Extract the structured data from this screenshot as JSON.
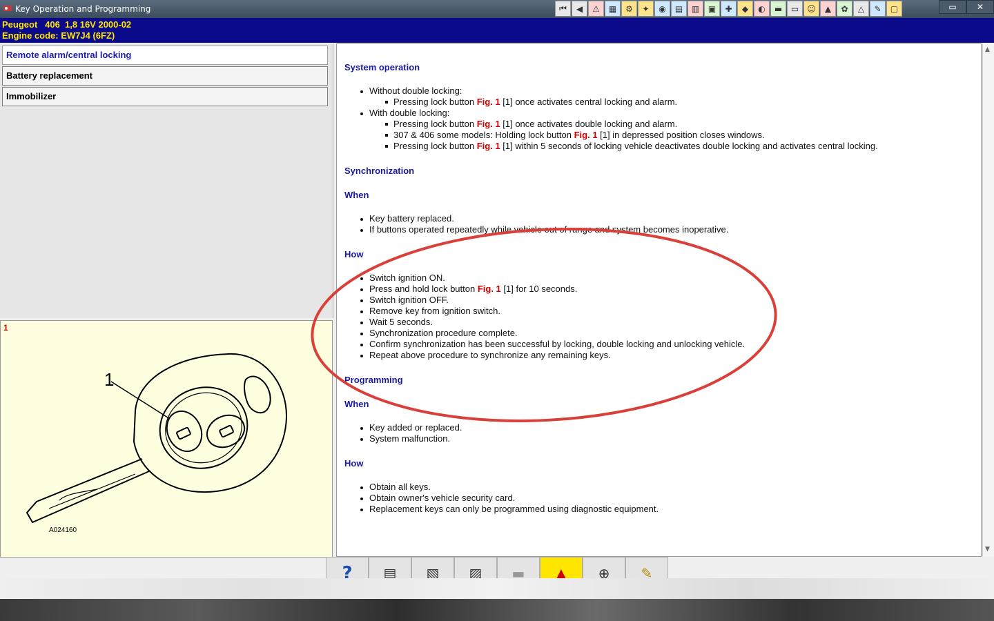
{
  "window": {
    "title": "Key Operation and Programming"
  },
  "vehicle": {
    "line1": "Peugeot   406  1,8 16V 2000-02",
    "line2": "Engine code: EW7J4 (6FZ)"
  },
  "sidebar": {
    "items": [
      {
        "label": "Remote alarm/central locking"
      },
      {
        "label": "Battery replacement"
      },
      {
        "label": "Immobilizer"
      }
    ]
  },
  "figure": {
    "number": "1",
    "callout": "1",
    "ref": "A024160"
  },
  "content": {
    "h_system": "System operation",
    "l1": "Without double locking:",
    "l1a_pre": "Pressing lock button ",
    "fig": "Fig. 1",
    "l1a_post": " [1] once activates central locking and alarm.",
    "l2": "With double locking:",
    "l2a_pre": "Pressing lock button ",
    "l2a_post": " [1] once activates double locking and alarm.",
    "l2b_pre": "307 & 406 some models: Holding lock button ",
    "l2b_post": " [1] in depressed position closes windows.",
    "l2c_pre": "Pressing lock button ",
    "l2c_post": " [1] within 5 seconds of locking vehicle deactivates double locking and activates central locking.",
    "h_sync": "Synchronization",
    "h_when": "When",
    "s_w1": "Key battery replaced.",
    "s_w2": "If buttons operated repeatedly while vehicle out of range and system becomes inoperative.",
    "h_how": "How",
    "s_h1": "Switch ignition ON.",
    "s_h2_pre": "Press and hold lock button ",
    "s_h2_post": " [1] for 10 seconds.",
    "s_h3": "Switch ignition OFF.",
    "s_h4": "Remove key from ignition switch.",
    "s_h5": "Wait 5 seconds.",
    "s_h6": "Synchronization procedure complete.",
    "s_h7": "Confirm synchronization has been successful by locking, double locking and unlocking vehicle.",
    "s_h8": "Repeat above procedure to synchronize any remaining keys.",
    "h_prog": "Programming",
    "p_w1": "Key added or replaced.",
    "p_w2": "System malfunction.",
    "p_h1": "Obtain all keys.",
    "p_h2": "Obtain owner's vehicle security card.",
    "p_h3": "Replacement keys can only be programmed using diagnostic equipment."
  },
  "toolbar_icons": [
    "first-icon",
    "back-icon",
    "warning-icon",
    "diagram-icon",
    "engine-icon",
    "tools-icon",
    "gauge-icon",
    "map-icon",
    "chart-icon",
    "battery-icon",
    "wrench-icon",
    "oil-icon",
    "timing-icon",
    "settings-icon",
    "book-icon",
    "person-icon",
    "car-icon",
    "fan-icon",
    "alert-icon",
    "service-icon",
    "note-icon"
  ],
  "bottom_icons": [
    "help-icon",
    "print-icon",
    "copy-icon",
    "paste-icon",
    "car-gray-icon",
    "car-red-icon",
    "search-icon",
    "notepad-icon"
  ],
  "colors": {
    "title_bg": "#3c4c5c",
    "vehicle_bg": "#0a0a8a",
    "vehicle_text": "#ffe600",
    "heading": "#1a1aa0",
    "fig_ref": "#d00000",
    "annotation": "#d9403a"
  }
}
